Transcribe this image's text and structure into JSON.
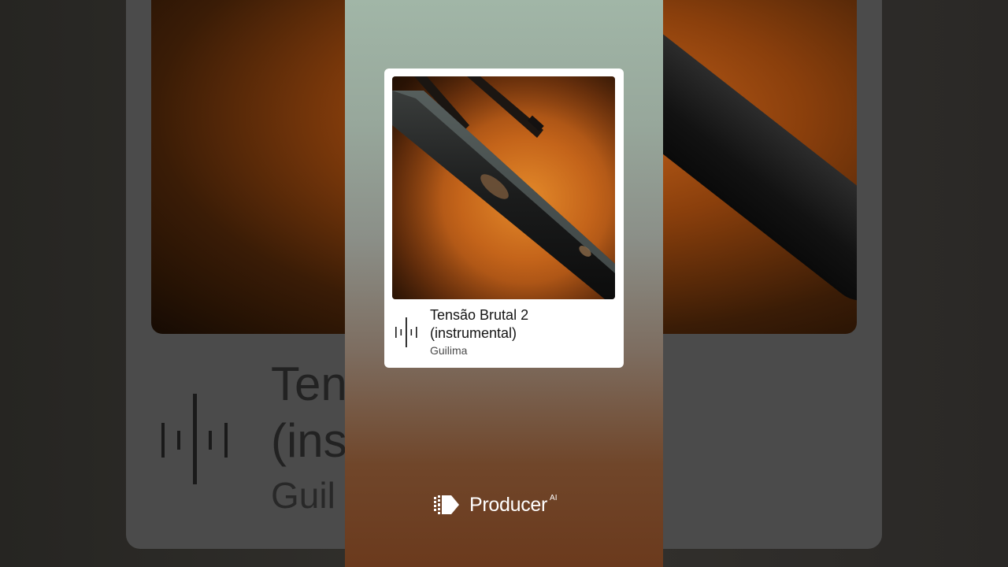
{
  "track": {
    "title_line1": "Tensão Brutal 2",
    "title_line2": "(instrumental)",
    "artist": "Guilima"
  },
  "background": {
    "title_fragment": "Ten\n(ins",
    "artist_fragment": "Guil"
  },
  "brand": {
    "name": "Producer",
    "suffix": "AI"
  },
  "icons": {
    "waveform": "waveform-icon",
    "logo": "producer-logo-icon"
  },
  "colors": {
    "card": "#ffffff",
    "art_orange": "#c4641a",
    "text": "#141414"
  }
}
